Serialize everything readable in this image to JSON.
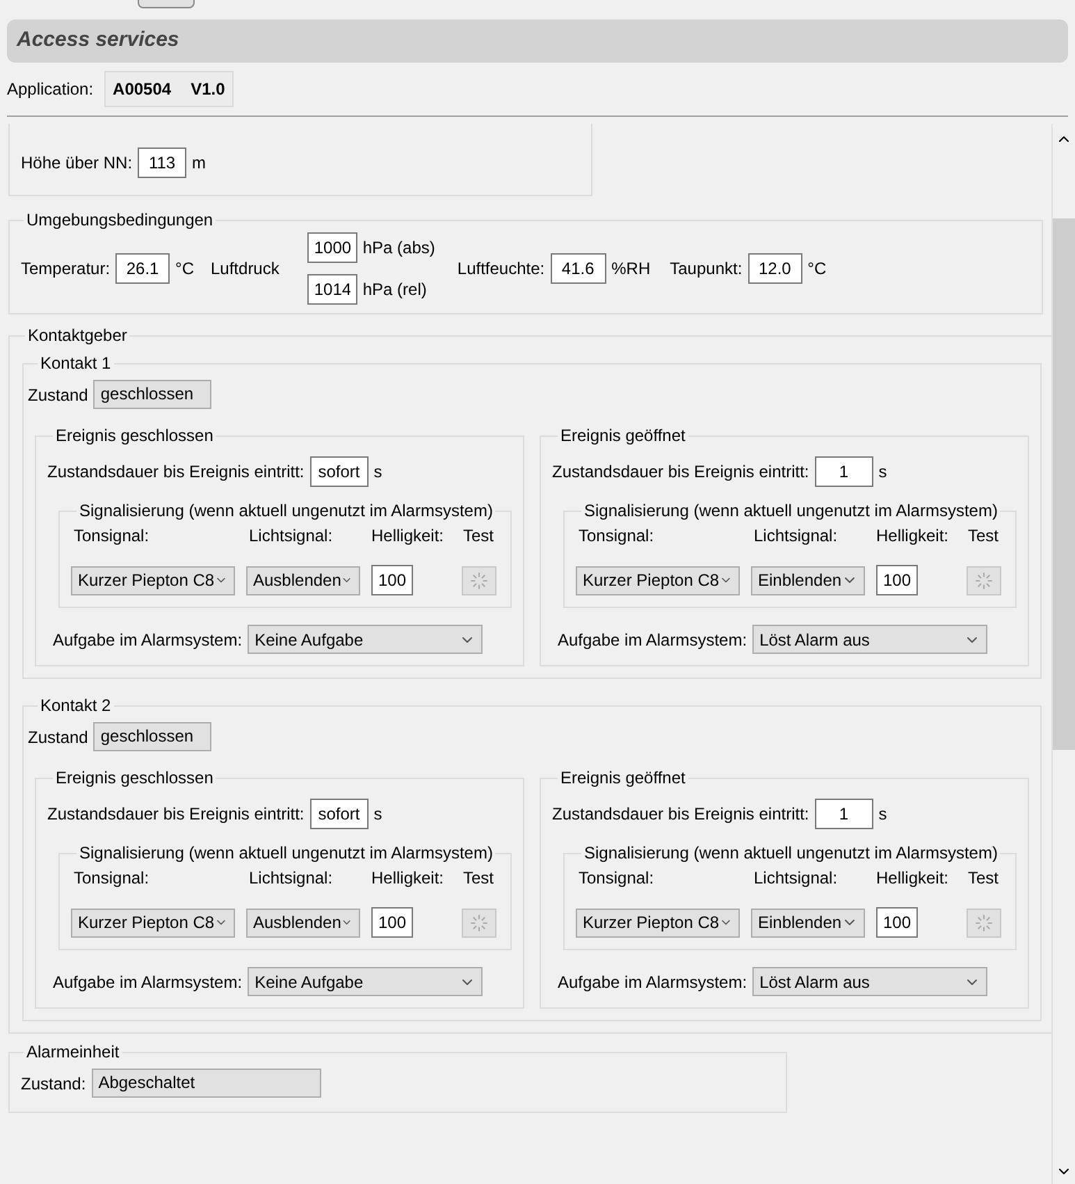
{
  "header": {
    "title": "Access services"
  },
  "application": {
    "label": "Application:",
    "code": "A00504",
    "version": "V1.0"
  },
  "device": {
    "altitude_label": "Höhe über NN:",
    "altitude": "113",
    "altitude_unit": "m"
  },
  "environment": {
    "title": "Umgebungsbedingungen",
    "temperature_label": "Temperatur:",
    "temperature": "26.1",
    "temperature_unit": "°C",
    "pressure_label": "Luftdruck",
    "pressure_abs": "1000",
    "pressure_abs_unit": "hPa (abs)",
    "pressure_rel": "1014",
    "pressure_rel_unit": "hPa (rel)",
    "humidity_label": "Luftfeuchte:",
    "humidity": "41.6",
    "humidity_unit": "%RH",
    "dewpoint_label": "Taupunkt:",
    "dewpoint": "12.0",
    "dewpoint_unit": "°C"
  },
  "contacts": {
    "title": "Kontaktgeber",
    "items": [
      {
        "title": "Kontakt 1",
        "state_label": "Zustand",
        "state": "geschlossen",
        "events": [
          {
            "title": "Ereignis geschlossen",
            "duration_label": "Zustandsdauer bis Ereignis eintritt:",
            "duration": "sofort",
            "duration_unit": "s",
            "signal_title": "Signalisierung (wenn aktuell ungenutzt im Alarmsystem)",
            "tone_label": "Tonsignal:",
            "light_label": "Lichtsignal:",
            "brightness_label": "Helligkeit:",
            "test_label": "Test",
            "tone": "Kurzer Piepton C8",
            "light": "Ausblenden",
            "brightness": "100",
            "task_label": "Aufgabe im Alarmsystem:",
            "task": "Keine Aufgabe"
          },
          {
            "title": "Ereignis geöffnet",
            "duration_label": "Zustandsdauer bis Ereignis eintritt:",
            "duration": "1",
            "duration_unit": "s",
            "signal_title": "Signalisierung (wenn aktuell ungenutzt im Alarmsystem)",
            "tone_label": "Tonsignal:",
            "light_label": "Lichtsignal:",
            "brightness_label": "Helligkeit:",
            "test_label": "Test",
            "tone": "Kurzer Piepton C8",
            "light": "Einblenden",
            "brightness": "100",
            "task_label": "Aufgabe im Alarmsystem:",
            "task": "Löst Alarm aus"
          }
        ]
      },
      {
        "title": "Kontakt 2",
        "state_label": "Zustand",
        "state": "geschlossen",
        "events": [
          {
            "title": "Ereignis geschlossen",
            "duration_label": "Zustandsdauer bis Ereignis eintritt:",
            "duration": "sofort",
            "duration_unit": "s",
            "signal_title": "Signalisierung (wenn aktuell ungenutzt im Alarmsystem)",
            "tone_label": "Tonsignal:",
            "light_label": "Lichtsignal:",
            "brightness_label": "Helligkeit:",
            "test_label": "Test",
            "tone": "Kurzer Piepton C8",
            "light": "Ausblenden",
            "brightness": "100",
            "task_label": "Aufgabe im Alarmsystem:",
            "task": "Keine Aufgabe"
          },
          {
            "title": "Ereignis geöffnet",
            "duration_label": "Zustandsdauer bis Ereignis eintritt:",
            "duration": "1",
            "duration_unit": "s",
            "signal_title": "Signalisierung (wenn aktuell ungenutzt im Alarmsystem)",
            "tone_label": "Tonsignal:",
            "light_label": "Lichtsignal:",
            "brightness_label": "Helligkeit:",
            "test_label": "Test",
            "tone": "Kurzer Piepton C8",
            "light": "Einblenden",
            "brightness": "100",
            "task_label": "Aufgabe im Alarmsystem:",
            "task": "Löst Alarm aus"
          }
        ]
      }
    ]
  },
  "alarm_unit": {
    "title": "Alarmeinheit",
    "state_label": "Zustand:",
    "state": "Abgeschaltet"
  }
}
